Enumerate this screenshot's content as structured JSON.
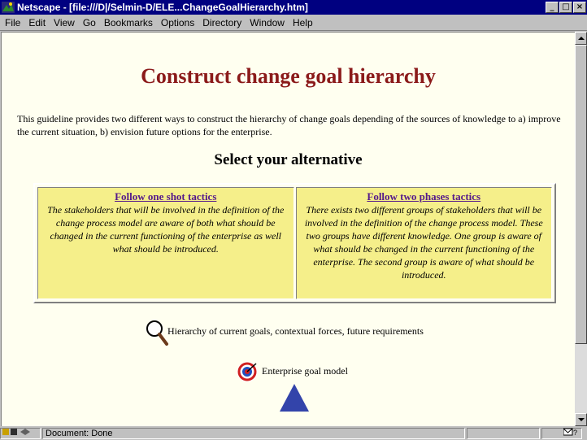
{
  "window": {
    "title": "Netscape - [file:///D|/Selmin-D/ELE...ChangeGoalHierarchy.htm]"
  },
  "menu": [
    "File",
    "Edit",
    "View",
    "Go",
    "Bookmarks",
    "Options",
    "Directory",
    "Window",
    "Help"
  ],
  "page": {
    "heading": "Construct change goal hierarchy",
    "intro": "This guideline provides two different ways to construct the hierarchy of change goals depending of the sources of knowledge to a) improve the current situation, b) envision future options for the enterprise.",
    "subheading": "Select your alternative",
    "alternatives": [
      {
        "link": "Follow one shot tactics",
        "description": "The stakeholders that will be involved in the definition of the change process model are aware of both what should be changed in the current functioning of the enterprise as well what should be introduced."
      },
      {
        "link": "Follow two phases tactics",
        "description": "There exists two different groups of stakeholders that will be involved in the definition of the change process model. These two groups have different knowledge. One group is aware of what should be changed in the current functioning of the enterprise. The second group is aware of what should be introduced."
      }
    ],
    "link_hierarchy": "Hierarchy of current goals, contextual forces, future requirements",
    "link_goal_model": "Enterprise goal model"
  },
  "status": {
    "text": "Document: Done"
  },
  "icons": {
    "magnifier": "magnifier-icon",
    "target": "target-icon",
    "pyramid": "pyramid-icon",
    "security": "security-icon",
    "mail": "mail-icon"
  }
}
